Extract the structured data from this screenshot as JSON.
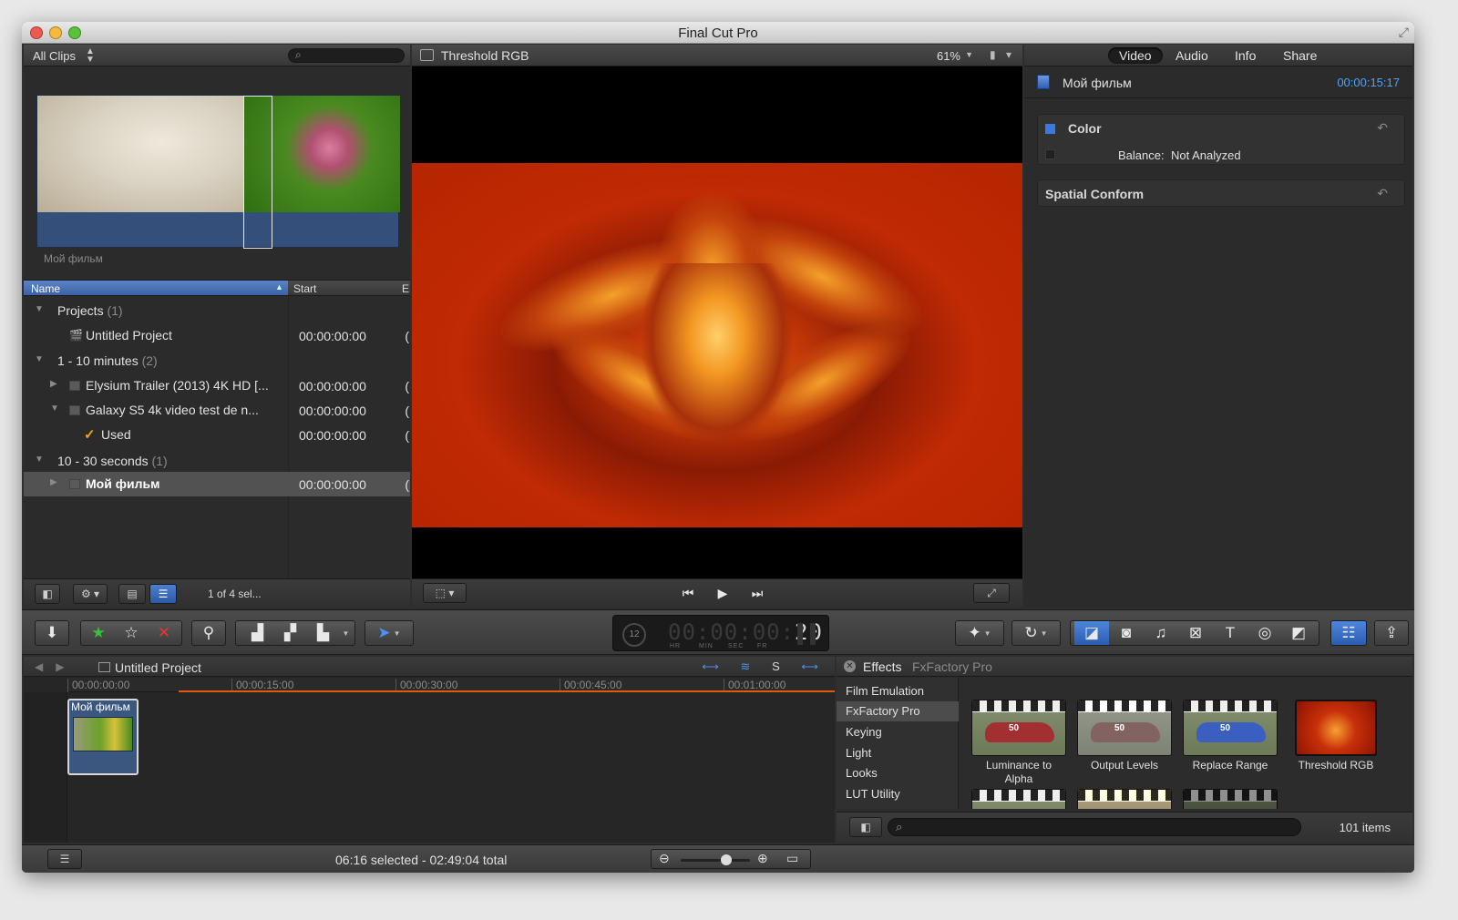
{
  "window": {
    "title": "Final Cut Pro"
  },
  "browser": {
    "filter_label": "All Clips",
    "filmstrip_caption": "Мой фильм",
    "columns": {
      "name": "Name",
      "start": "Start",
      "end": "E"
    },
    "rows": [
      {
        "name": "Projects",
        "count": "(1)",
        "start": ""
      },
      {
        "name": "Untitled Project",
        "count": "",
        "start": "00:00:00:00"
      },
      {
        "name": "1 - 10 minutes",
        "count": "(2)",
        "start": ""
      },
      {
        "name": "Elysium Trailer (2013) 4K HD [...",
        "count": "",
        "start": "00:00:00:00"
      },
      {
        "name": "Galaxy S5 4k video test de n...",
        "count": "",
        "start": "00:00:00:00"
      },
      {
        "name": "Used",
        "count": "",
        "start": "00:00:00:00"
      },
      {
        "name": "10 - 30 seconds",
        "count": "(1)",
        "start": ""
      },
      {
        "name": "Мой фильм",
        "count": "",
        "start": "00:00:00:00"
      }
    ],
    "selection_status": "1 of 4 sel..."
  },
  "viewer": {
    "title": "Threshold RGB",
    "zoom": "61%"
  },
  "inspector": {
    "tabs": [
      "Video",
      "Audio",
      "Info",
      "Share"
    ],
    "active_tab": "Video",
    "clip_name": "Мой фильм",
    "clip_duration": "00:00:15:17",
    "color_section": "Color",
    "balance_label": "Balance:",
    "balance_value": "Not Analyzed",
    "spatial_section": "Spatial Conform"
  },
  "timecode": {
    "percent": "12",
    "digits_dim": "00:00:00:",
    "digits_lit": "20",
    "units": [
      "HR",
      "MIN",
      "SEC",
      "FR"
    ]
  },
  "timeline": {
    "project": "Untitled Project",
    "ruler": [
      "00:00:00:00",
      "00:00:15:00",
      "00:00:30:00",
      "00:00:45:00",
      "00:01:00:00"
    ],
    "clip_label": "Мой фильм"
  },
  "effects": {
    "title": "Effects",
    "subtitle": "FxFactory Pro",
    "categories": [
      "Film Emulation",
      "FxFactory Pro",
      "Keying",
      "Light",
      "Looks",
      "LUT Utility"
    ],
    "selected_category": "FxFactory Pro",
    "items": [
      "Luminance to Alpha",
      "Output Levels",
      "Replace Range",
      "Threshold RGB"
    ],
    "count": "101 items"
  },
  "status": {
    "selection": "06:16 selected - 02:49:04 total"
  },
  "colors": {
    "accent_blue": "#3a7ae0",
    "timecode_blue": "#4aa4ff",
    "range_orange": "#e05a14",
    "used_check": "#f3a21e"
  }
}
